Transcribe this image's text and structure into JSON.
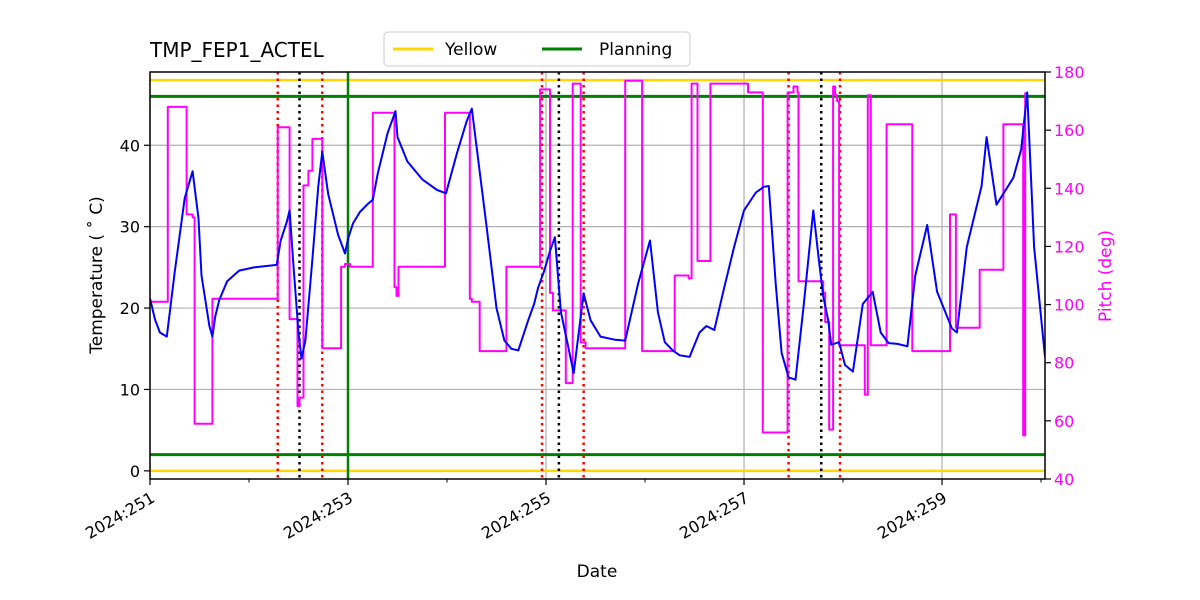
{
  "chart_data": {
    "type": "line",
    "title": "TMP_FEP1_ACTEL",
    "xlabel": "Date",
    "ylabel": "Temperature ($^\\circ$C)",
    "ylabel_display": "Temperature ( ˚ C)",
    "y2label": "Pitch (deg)",
    "xlim": [
      251.0,
      260.04
    ],
    "ylim": [
      -1.0,
      49.0
    ],
    "y2lim": [
      40,
      180
    ],
    "grid": true,
    "legend_placement": "top-center (above axes)",
    "x_ticks": [
      {
        "value": 251,
        "label": "2024:251"
      },
      {
        "value": 253,
        "label": "2024:253"
      },
      {
        "value": 255,
        "label": "2024:255"
      },
      {
        "value": 257,
        "label": "2024:257"
      },
      {
        "value": 259,
        "label": "2024:259"
      }
    ],
    "x_minor_ticks": [
      252,
      254,
      256,
      258,
      260
    ],
    "y_ticks": [
      0,
      10,
      20,
      30,
      40
    ],
    "y2_ticks": [
      40,
      60,
      80,
      100,
      120,
      140,
      160,
      180
    ],
    "colors": {
      "temperature": "#0000ff",
      "pitch": "#ff00ff",
      "yellow_limit": "#ffd700",
      "planning_limit": "#008000",
      "red_markers": "#ff0000",
      "black_markers": "#000000",
      "now_line": "#008000",
      "grid": "#b0b0b0"
    },
    "legend": [
      {
        "label": "Yellow",
        "color": "#ffd700"
      },
      {
        "label": "Planning",
        "color": "#008000"
      }
    ],
    "limits": {
      "yellow": [
        0.0,
        48.0
      ],
      "planning": [
        2.0,
        46.0
      ]
    },
    "vertical_markers": {
      "red_dotted": [
        252.29,
        252.74,
        254.96,
        255.38,
        257.45,
        257.97
      ],
      "black_dotted": [
        252.51,
        255.13,
        257.78
      ],
      "green_solid": [
        253.0
      ]
    },
    "series": [
      {
        "name": "Temperature",
        "axis": "left",
        "x": [
          251.0,
          251.05,
          251.1,
          251.17,
          251.25,
          251.35,
          251.43,
          251.49,
          251.52,
          251.6,
          251.63,
          251.66,
          251.7,
          251.78,
          251.9,
          252.05,
          252.2,
          252.28,
          252.32,
          252.38,
          252.41,
          252.45,
          252.5,
          252.53,
          252.57,
          252.64,
          252.7,
          252.74,
          252.8,
          252.9,
          252.97,
          253.0,
          253.05,
          253.12,
          253.2,
          253.25,
          253.3,
          253.4,
          253.48,
          253.5,
          253.6,
          253.75,
          253.9,
          253.99,
          254.1,
          254.2,
          254.25,
          254.4,
          254.5,
          254.58,
          254.65,
          254.72,
          254.82,
          254.88,
          254.92,
          254.98,
          255.04,
          255.09,
          255.15,
          255.22,
          255.28,
          255.38,
          255.45,
          255.55,
          255.7,
          255.8,
          255.93,
          256.05,
          256.13,
          256.2,
          256.28,
          256.35,
          256.45,
          256.55,
          256.62,
          256.7,
          256.8,
          256.9,
          257.0,
          257.12,
          257.2,
          257.25,
          257.32,
          257.38,
          257.45,
          257.52,
          257.6,
          257.7,
          257.75,
          257.8,
          257.85,
          257.88,
          257.96,
          258.02,
          258.1,
          258.2,
          258.3,
          258.38,
          258.46,
          258.55,
          258.65,
          258.73,
          258.85,
          258.95,
          259.1,
          259.15,
          259.25,
          259.4,
          259.45,
          259.55,
          259.72,
          259.8,
          259.86,
          259.93,
          260.04
        ],
        "y": [
          21.2,
          18.6,
          17.0,
          16.5,
          24.5,
          33.5,
          36.8,
          31.0,
          24.0,
          17.8,
          16.5,
          19.0,
          21.0,
          23.3,
          24.6,
          25.0,
          25.2,
          25.3,
          28.3,
          30.5,
          32.0,
          25.0,
          17.0,
          13.8,
          16.0,
          26.0,
          35.0,
          39.2,
          34.0,
          29.0,
          26.7,
          28.5,
          30.4,
          31.8,
          32.8,
          33.3,
          36.5,
          41.5,
          44.2,
          41.0,
          38.0,
          35.8,
          34.5,
          34.1,
          39.0,
          43.0,
          44.5,
          30.0,
          20.0,
          16.0,
          15.0,
          14.8,
          18.5,
          20.5,
          22.5,
          24.5,
          27.0,
          28.7,
          19.5,
          15.5,
          12.0,
          21.8,
          18.5,
          16.5,
          16.1,
          16.0,
          23.0,
          28.3,
          19.5,
          15.8,
          14.8,
          14.2,
          14.0,
          17.0,
          17.8,
          17.3,
          22.5,
          27.5,
          32.0,
          34.2,
          34.9,
          35.0,
          23.0,
          14.5,
          11.5,
          11.2,
          20.0,
          32.0,
          26.5,
          21.5,
          18.5,
          15.5,
          15.8,
          13.0,
          12.2,
          20.5,
          22.0,
          17.0,
          15.7,
          15.6,
          15.3,
          24.0,
          30.2,
          22.0,
          17.5,
          17.0,
          27.5,
          35.0,
          41.0,
          32.7,
          36.0,
          39.5,
          46.5,
          27.5,
          14.0,
          26.0
        ],
        "note": "Values approximated from the plotted curve; thermal model prediction"
      },
      {
        "name": "Pitch",
        "axis": "right",
        "x": [
          251.0,
          251.18,
          251.18,
          251.37,
          251.37,
          251.43,
          251.43,
          251.45,
          251.45,
          251.63,
          251.63,
          252.29,
          252.29,
          252.41,
          252.41,
          252.49,
          252.49,
          252.51,
          252.51,
          252.55,
          252.55,
          252.6,
          252.6,
          252.64,
          252.64,
          252.74,
          252.74,
          252.93,
          252.93,
          252.97,
          252.97,
          253.02,
          253.02,
          253.25,
          253.25,
          253.47,
          253.47,
          253.49,
          253.49,
          253.51,
          253.51,
          253.98,
          253.98,
          254.23,
          254.23,
          254.25,
          254.25,
          254.33,
          254.33,
          254.6,
          254.6,
          254.94,
          254.94,
          255.04,
          255.04,
          255.07,
          255.07,
          255.2,
          255.2,
          255.27,
          255.27,
          255.35,
          255.35,
          255.4,
          255.4,
          255.8,
          255.8,
          255.97,
          255.97,
          256.3,
          256.3,
          256.44,
          256.44,
          256.47,
          256.47,
          256.53,
          256.53,
          256.66,
          256.66,
          257.04,
          257.04,
          257.19,
          257.19,
          257.44,
          257.44,
          257.5,
          257.5,
          257.54,
          257.54,
          257.55,
          257.55,
          257.8,
          257.8,
          257.82,
          257.82,
          257.86,
          257.86,
          257.9,
          257.9,
          257.92,
          257.92,
          257.94,
          257.94,
          257.96,
          257.96,
          258.22,
          258.22,
          258.25,
          258.25,
          258.28,
          258.28,
          258.44,
          258.44,
          258.7,
          258.7,
          259.08,
          259.08,
          259.14,
          259.14,
          259.38,
          259.38,
          259.62,
          259.62,
          259.82,
          259.82,
          259.84,
          259.84
        ],
        "y": [
          101,
          101,
          168,
          168,
          131,
          131,
          130,
          130,
          59,
          59,
          102,
          102,
          161,
          161,
          95,
          95,
          65,
          65,
          68,
          68,
          141,
          141,
          146,
          146,
          157,
          157,
          85,
          85,
          113,
          113,
          114,
          114,
          113,
          113,
          166,
          166,
          106,
          106,
          103,
          103,
          113,
          113,
          166,
          166,
          102,
          102,
          101,
          101,
          84,
          84,
          113,
          113,
          174,
          174,
          104,
          104,
          98,
          98,
          73,
          73,
          176,
          176,
          87,
          87,
          85,
          85,
          177,
          177,
          84,
          84,
          110,
          110,
          109,
          109,
          176,
          176,
          115,
          115,
          176,
          176,
          173,
          173,
          56,
          56,
          173,
          173,
          175,
          175,
          173,
          173,
          108,
          108,
          104,
          104,
          94,
          94,
          57,
          57,
          175,
          175,
          172,
          172,
          170,
          170,
          86,
          86,
          69,
          69,
          172,
          172,
          86,
          86,
          162,
          162,
          84,
          84,
          131,
          131,
          92,
          92,
          112,
          112,
          162,
          162,
          55,
          55,
          173,
          173
        ],
        "note": "Step-function pitch profile; approximate"
      }
    ]
  }
}
